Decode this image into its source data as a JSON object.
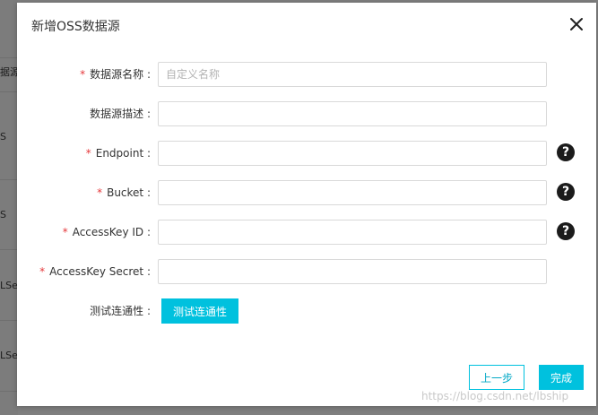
{
  "background": {
    "fragments": [
      "据源",
      "S",
      "S",
      "LSe",
      "LSe"
    ]
  },
  "dialog": {
    "title": "新增OSS数据源",
    "close_icon": "close-icon"
  },
  "form": {
    "fields": [
      {
        "label": "数据源名称 :",
        "required": true,
        "placeholder": "自定义名称",
        "value": "",
        "help": false
      },
      {
        "label": "数据源描述 :",
        "required": false,
        "placeholder": "",
        "value": "",
        "help": false
      },
      {
        "label": "Endpoint :",
        "required": true,
        "placeholder": "",
        "value": "",
        "help": true
      },
      {
        "label": "Bucket :",
        "required": true,
        "placeholder": "",
        "value": "",
        "help": true
      },
      {
        "label": "AccessKey ID :",
        "required": true,
        "placeholder": "",
        "value": "",
        "help": true
      },
      {
        "label": "AccessKey Secret :",
        "required": true,
        "placeholder": "",
        "value": "",
        "help": false
      }
    ],
    "connectivity": {
      "label": "测试连通性 :",
      "button_label": "测试连通性"
    },
    "required_mark": "*",
    "help_glyph": "?"
  },
  "footer": {
    "prev_label": "上一步",
    "done_label": "完成"
  },
  "watermark": "https://blog.csdn.net/lbship",
  "colors": {
    "accent": "#00c1de",
    "required": "#e5383b",
    "overlay": "#7f7f7f"
  }
}
